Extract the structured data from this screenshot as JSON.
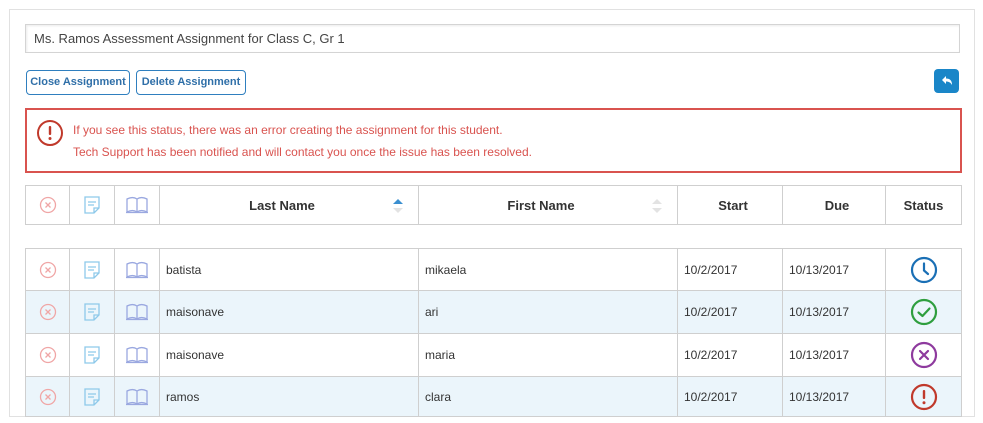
{
  "assignment": {
    "title": "Ms. Ramos Assessment Assignment for Class C, Gr 1"
  },
  "toolbar": {
    "close_label": "Close Assignment",
    "delete_label": "Delete Assignment",
    "back_icon": "back-arrow-icon"
  },
  "alert": {
    "icon": "exclamation-circle-icon",
    "line1": "If you see this status, there was an error creating the assignment for this student.",
    "line2": "Tech Support has been notified and will contact you once the issue has been resolved.",
    "color": "#d9534f"
  },
  "table": {
    "header_icons": [
      "remove-icon",
      "note-icon",
      "book-icon"
    ],
    "columns": [
      "Last Name",
      "First Name",
      "Start",
      "Due",
      "Status"
    ],
    "sort": {
      "column": "Last Name",
      "direction": "ascending"
    },
    "rows": [
      {
        "last": "batista",
        "first": "mikaela",
        "start": "10/2/2017",
        "due": "10/13/2017",
        "status": "clock-icon",
        "status_color": "#1a6fb5"
      },
      {
        "last": "maisonave",
        "first": "ari",
        "start": "10/2/2017",
        "due": "10/13/2017",
        "status": "check-circle-icon",
        "status_color": "#2e9e3e"
      },
      {
        "last": "maisonave",
        "first": "maria",
        "start": "10/2/2017",
        "due": "10/13/2017",
        "status": "x-circle-icon",
        "status_color": "#8e3a9e"
      },
      {
        "last": "ramos",
        "first": "clara",
        "start": "10/2/2017",
        "due": "10/13/2017",
        "status": "exclamation-circle-icon",
        "status_color": "#c0392b"
      }
    ]
  },
  "colors": {
    "accent": "#1a86c8",
    "row_alt": "#ebf5fb",
    "remove_icon": "#f0a6a6",
    "note_icon": "#8ec9ea",
    "book_icon": "#9aa8e0"
  }
}
